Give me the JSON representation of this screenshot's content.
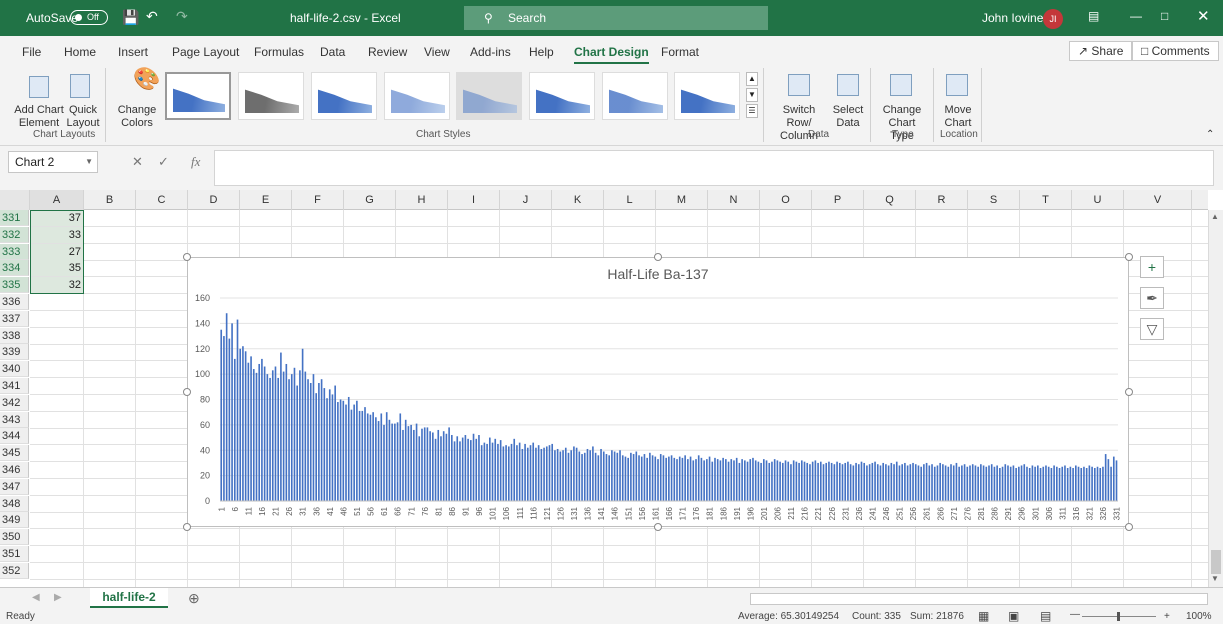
{
  "titlebar": {
    "autosave": "AutoSave",
    "toggle": "Off",
    "filename": "half-life-2.csv - Excel",
    "search": "Search",
    "user": "John Iovine",
    "initials": "JI"
  },
  "tabs": [
    "File",
    "Home",
    "Insert",
    "Page Layout",
    "Formulas",
    "Data",
    "Review",
    "View",
    "Add-ins",
    "Help",
    "Chart Design",
    "Format"
  ],
  "share": "Share",
  "comments": "Comments",
  "ribbon": {
    "add_chart_element": "Add Chart Element",
    "quick_layout": "Quick Layout",
    "change_colors": "Change Colors",
    "chart_layouts": "Chart Layouts",
    "chart_styles": "Chart Styles",
    "switch_row_column": "Switch Row/ Column",
    "select_data": "Select Data",
    "data_group": "Data",
    "change_chart_type": "Change Chart Type",
    "type_group": "Type",
    "move_chart": "Move Chart",
    "location_group": "Location"
  },
  "namebox": "Chart 2",
  "columns": [
    "A",
    "B",
    "C",
    "D",
    "E",
    "F",
    "G",
    "H",
    "I",
    "J",
    "K",
    "L",
    "M",
    "N",
    "O",
    "P",
    "Q",
    "R",
    "S",
    "T",
    "U",
    "V"
  ],
  "rows": [
    {
      "n": "331",
      "a": "37"
    },
    {
      "n": "332",
      "a": "33"
    },
    {
      "n": "333",
      "a": "27"
    },
    {
      "n": "334",
      "a": "35"
    },
    {
      "n": "335",
      "a": "32"
    },
    {
      "n": "336",
      "a": ""
    },
    {
      "n": "337",
      "a": ""
    },
    {
      "n": "338",
      "a": ""
    },
    {
      "n": "339",
      "a": ""
    },
    {
      "n": "340",
      "a": ""
    },
    {
      "n": "341",
      "a": ""
    },
    {
      "n": "342",
      "a": ""
    },
    {
      "n": "343",
      "a": ""
    },
    {
      "n": "344",
      "a": ""
    },
    {
      "n": "345",
      "a": ""
    },
    {
      "n": "346",
      "a": ""
    },
    {
      "n": "347",
      "a": ""
    },
    {
      "n": "348",
      "a": ""
    },
    {
      "n": "349",
      "a": ""
    },
    {
      "n": "350",
      "a": ""
    },
    {
      "n": "351",
      "a": ""
    },
    {
      "n": "352",
      "a": ""
    }
  ],
  "chart_data": {
    "type": "bar",
    "title": "Half-Life Ba-137",
    "ylim": [
      0,
      160
    ],
    "yticks": [
      0,
      20,
      40,
      60,
      80,
      100,
      120,
      140,
      160
    ],
    "x_first": 1,
    "x_last": 335,
    "x_tick_step": 5,
    "grid": true,
    "color": "#4472c4",
    "values": [
      135,
      130,
      148,
      128,
      140,
      112,
      143,
      120,
      122,
      118,
      109,
      114,
      104,
      101,
      108,
      112,
      106,
      100,
      97,
      103,
      106,
      97,
      117,
      102,
      108,
      96,
      100,
      105,
      91,
      103,
      120,
      102,
      96,
      93,
      100,
      85,
      93,
      96,
      89,
      81,
      88,
      84,
      91,
      78,
      80,
      79,
      76,
      82,
      72,
      76,
      79,
      71,
      71,
      74,
      69,
      68,
      70,
      66,
      63,
      69,
      60,
      70,
      64,
      61,
      61,
      62,
      69,
      56,
      64,
      59,
      60,
      56,
      61,
      51,
      57,
      58,
      58,
      55,
      54,
      49,
      56,
      51,
      55,
      53,
      58,
      52,
      47,
      51,
      47,
      50,
      52,
      49,
      48,
      53,
      49,
      52,
      44,
      46,
      45,
      50,
      46,
      49,
      45,
      48,
      43,
      44,
      43,
      45,
      49,
      44,
      46,
      41,
      45,
      42,
      44,
      46,
      42,
      44,
      41,
      42,
      43,
      44,
      45,
      40,
      41,
      39,
      40,
      42,
      38,
      40,
      43,
      42,
      39,
      37,
      38,
      41,
      40,
      43,
      38,
      36,
      41,
      39,
      37,
      36,
      40,
      39,
      38,
      40,
      36,
      35,
      34,
      38,
      37,
      39,
      36,
      35,
      37,
      34,
      38,
      36,
      35,
      33,
      37,
      36,
      34,
      35,
      36,
      34,
      33,
      35,
      34,
      36,
      33,
      35,
      32,
      33,
      36,
      34,
      32,
      33,
      35,
      31,
      34,
      33,
      32,
      34,
      33,
      31,
      33,
      32,
      34,
      30,
      33,
      32,
      31,
      33,
      34,
      32,
      31,
      30,
      33,
      32,
      30,
      31,
      33,
      32,
      31,
      30,
      32,
      31,
      29,
      32,
      31,
      30,
      32,
      31,
      30,
      29,
      31,
      32,
      30,
      31,
      29,
      30,
      31,
      30,
      29,
      31,
      30,
      29,
      30,
      31,
      29,
      28,
      30,
      29,
      31,
      30,
      28,
      29,
      30,
      31,
      29,
      28,
      30,
      29,
      28,
      30,
      29,
      31,
      28,
      29,
      30,
      28,
      29,
      30,
      29,
      28,
      27,
      29,
      30,
      28,
      29,
      27,
      28,
      30,
      29,
      28,
      27,
      29,
      28,
      30,
      27,
      28,
      29,
      27,
      28,
      29,
      28,
      27,
      29,
      28,
      27,
      28,
      29,
      27,
      28,
      26,
      27,
      29,
      28,
      27,
      28,
      26,
      27,
      28,
      29,
      27,
      26,
      28,
      27,
      28,
      26,
      27,
      28,
      27,
      26,
      28,
      27,
      26,
      27,
      28,
      26,
      27,
      26,
      28,
      27,
      26,
      27,
      26,
      28,
      27,
      26,
      27,
      26,
      27,
      37,
      33,
      27,
      35,
      32
    ]
  },
  "sheet": "half-life-2",
  "status": {
    "ready": "Ready",
    "average": "Average: 65.30149254",
    "count": "Count: 335",
    "sum": "Sum: 21876",
    "zoom": "100%"
  }
}
